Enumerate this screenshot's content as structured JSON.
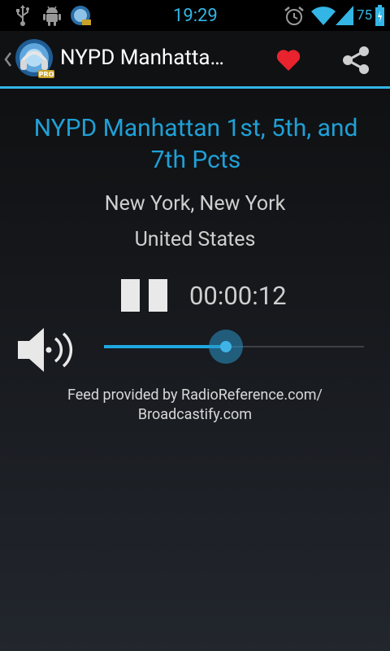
{
  "status_bar": {
    "time": "19:29",
    "battery_percent": "75",
    "icons": [
      "usb-icon",
      "android-debug-icon",
      "scanner-app-icon",
      "alarm-icon",
      "wifi-icon",
      "signal-icon",
      "battery-icon"
    ]
  },
  "action_bar": {
    "title": "NYPD Manhatta…",
    "back_icon": "chevron-left-icon",
    "app_icon": "scanner-radio-pro-icon",
    "favorite_icon": "heart-icon",
    "share_icon": "share-icon"
  },
  "feed": {
    "title_line1": "NYPD Manhattan 1st, 5th, and",
    "title_line2": "7th Pcts",
    "city_state": "New York,  New York",
    "country": "United States"
  },
  "player": {
    "elapsed": "00:00:12",
    "pause_icon": "pause-icon",
    "volume_icon": "speaker-volume-icon",
    "volume_level": 0.47
  },
  "credit": {
    "line1": "Feed provided by RadioReference.com/",
    "line2": "Broadcastify.com"
  },
  "colors": {
    "accent": "#33b5e5",
    "title_blue": "#1fa0d6",
    "heart_red": "#e8232e",
    "background_top": "#0d0d0e",
    "background_bottom": "#22262d"
  }
}
